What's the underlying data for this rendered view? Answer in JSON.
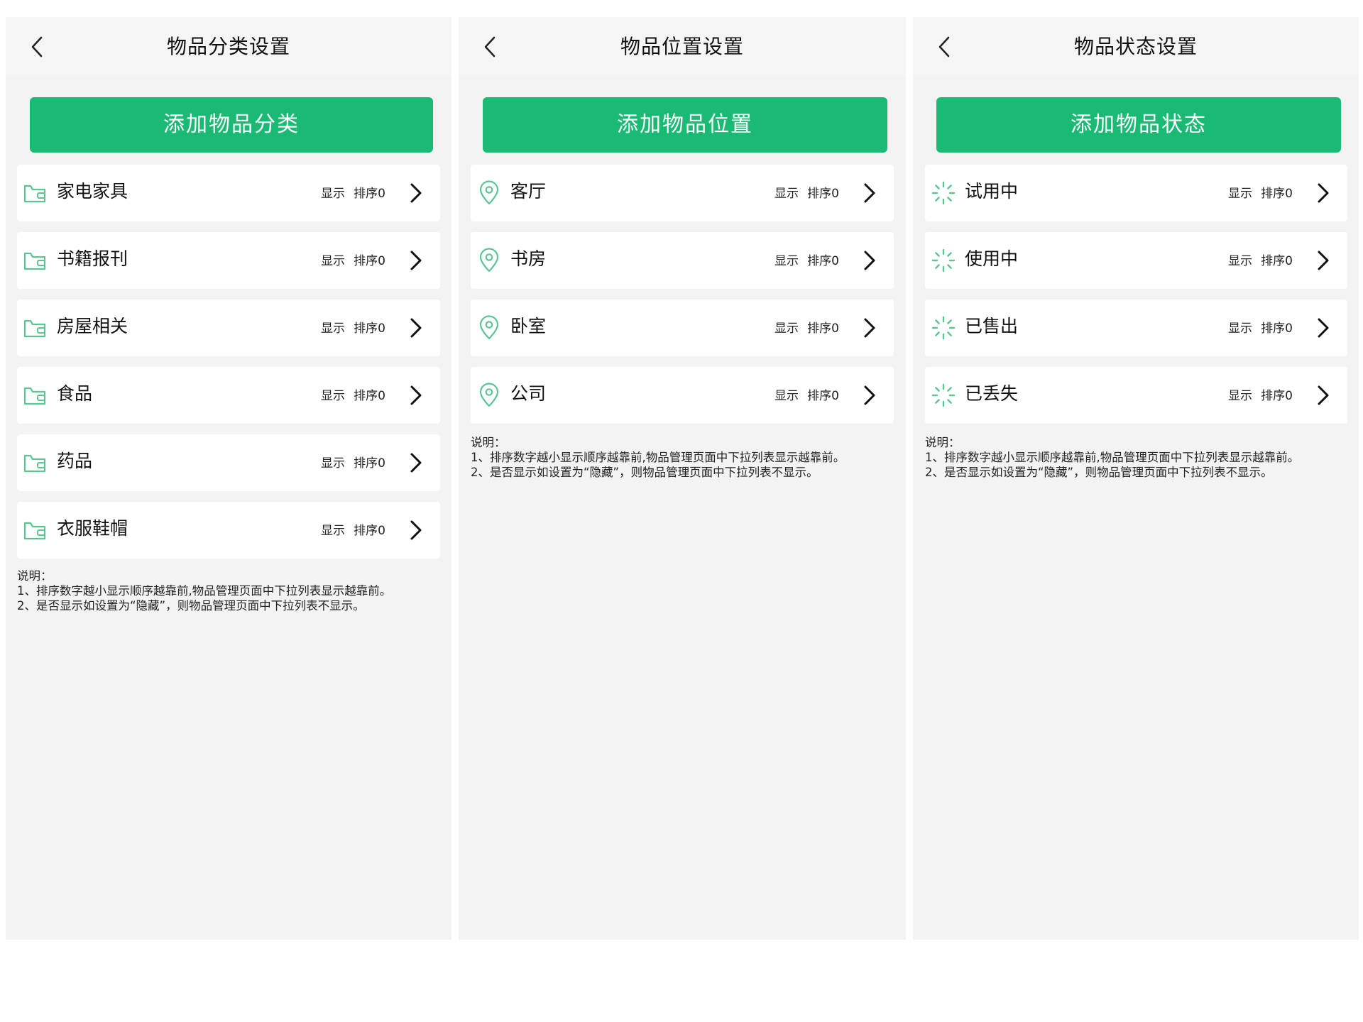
{
  "panels": [
    {
      "title": "物品分类设置",
      "add_label": "添加物品分类",
      "icon_type": "folder",
      "items": [
        {
          "label": "家电家具",
          "show": "显示",
          "sort": "排序0"
        },
        {
          "label": "书籍报刊",
          "show": "显示",
          "sort": "排序0"
        },
        {
          "label": "房屋相关",
          "show": "显示",
          "sort": "排序0"
        },
        {
          "label": "食品",
          "show": "显示",
          "sort": "排序0"
        },
        {
          "label": "药品",
          "show": "显示",
          "sort": "排序0"
        },
        {
          "label": "衣服鞋帽",
          "show": "显示",
          "sort": "排序0"
        }
      ],
      "note": {
        "title": "说明：",
        "line1": "1、排序数字越小显示顺序越靠前,物品管理页面中下拉列表显示越靠前。",
        "line2": "2、是否显示如设置为“隐藏”，则物品管理页面中下拉列表不显示。"
      }
    },
    {
      "title": "物品位置设置",
      "add_label": "添加物品位置",
      "icon_type": "location-pin",
      "items": [
        {
          "label": "客厅",
          "show": "显示",
          "sort": "排序0"
        },
        {
          "label": "书房",
          "show": "显示",
          "sort": "排序0"
        },
        {
          "label": "卧室",
          "show": "显示",
          "sort": "排序0"
        },
        {
          "label": "公司",
          "show": "显示",
          "sort": "排序0"
        }
      ],
      "note": {
        "title": "说明：",
        "line1": "1、排序数字越小显示顺序越靠前,物品管理页面中下拉列表显示越靠前。",
        "line2": "2、是否显示如设置为“隐藏”，则物品管理页面中下拉列表不显示。"
      }
    },
    {
      "title": "物品状态设置",
      "add_label": "添加物品状态",
      "icon_type": "loading-spinner",
      "items": [
        {
          "label": "试用中",
          "show": "显示",
          "sort": "排序0"
        },
        {
          "label": "使用中",
          "show": "显示",
          "sort": "排序0"
        },
        {
          "label": "已售出",
          "show": "显示",
          "sort": "排序0"
        },
        {
          "label": "已丢失",
          "show": "显示",
          "sort": "排序0"
        }
      ],
      "note": {
        "title": "说明：",
        "line1": "1、排序数字越小显示顺序越靠前,物品管理页面中下拉列表显示越靠前。",
        "line2": "2、是否显示如设置为“隐藏”，则物品管理页面中下拉列表不显示。"
      }
    }
  ],
  "colors": {
    "accent": "#1aba75",
    "icon": "#5cc592",
    "panel_bg": "#f3f3f3",
    "card_bg": "#ffffff",
    "text": "#111111"
  }
}
